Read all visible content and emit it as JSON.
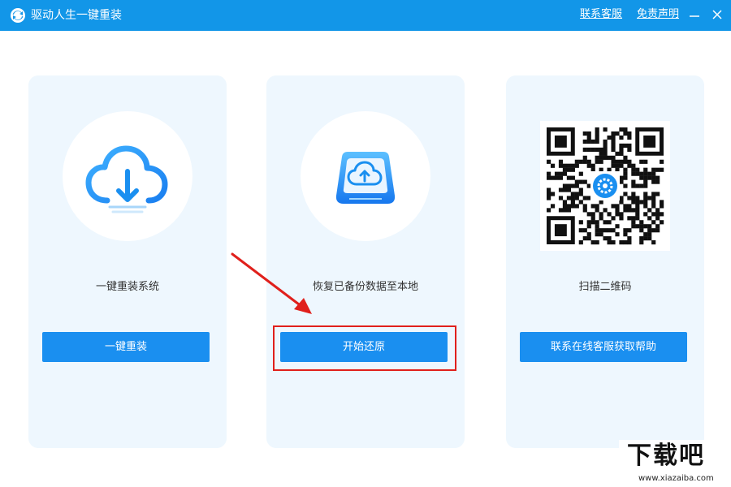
{
  "titlebar": {
    "title": "驱动人生一键重装",
    "links": {
      "support": "联系客服",
      "disclaimer": "免责声明"
    },
    "color": "#1296e8"
  },
  "cards": [
    {
      "icon": "cloud-download-icon",
      "label": "一键重装系统",
      "button": "一键重装"
    },
    {
      "icon": "cloud-upload-drive-icon",
      "label": "恢复已备份数据至本地",
      "button": "开始还原"
    },
    {
      "icon": "qr-code",
      "label": "扫描二维码",
      "button": "联系在线客服获取帮助"
    }
  ],
  "colors": {
    "accent": "#1a8ff0",
    "card_bg": "#eef7fe",
    "highlight": "#e0201c"
  },
  "watermark": {
    "name": "下载吧",
    "url": "www.xiazaiba.com"
  }
}
